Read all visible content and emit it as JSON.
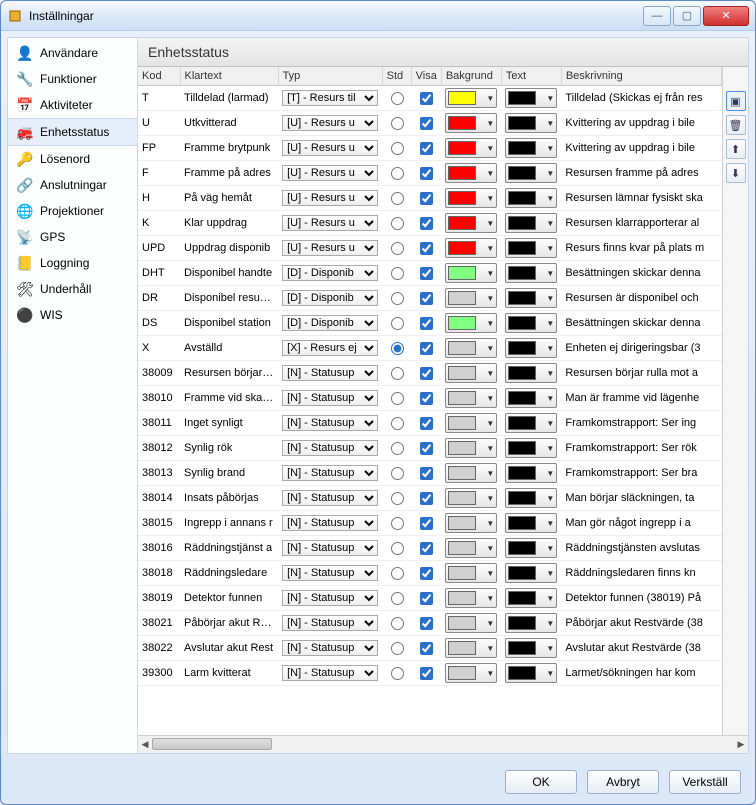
{
  "window": {
    "title": "Inställningar"
  },
  "sidebar": {
    "items": [
      {
        "label": "Användare"
      },
      {
        "label": "Funktioner"
      },
      {
        "label": "Aktiviteter"
      },
      {
        "label": "Enhetsstatus"
      },
      {
        "label": "Lösenord"
      },
      {
        "label": "Anslutningar"
      },
      {
        "label": "Projektioner"
      },
      {
        "label": "GPS"
      },
      {
        "label": "Loggning"
      },
      {
        "label": "Underhåll"
      },
      {
        "label": "WIS"
      }
    ]
  },
  "panel": {
    "title": "Enhetsstatus"
  },
  "columns": {
    "kod": "Kod",
    "klartext": "Klartext",
    "typ": "Typ",
    "std": "Std",
    "visa": "Visa",
    "bakgrund": "Bakgrund",
    "text": "Text",
    "beskrivning": "Beskrivning"
  },
  "typ_options": {
    "T": "[T] - Resurs til",
    "U": "[U] - Resurs u",
    "D": "[D] - Disponib",
    "X": "[X] - Resurs ej",
    "N": "[N] - Statusup"
  },
  "colors": {
    "yellow": "#ffff00",
    "red": "#ff0000",
    "green": "#80ff80",
    "gray": "#d0d0d0",
    "black": "#000000"
  },
  "rows": [
    {
      "kod": "T",
      "klartext": "Tilldelad (larmad)",
      "typ": "T",
      "std": true,
      "visa": true,
      "bg": "yellow",
      "txt": "black",
      "besk": "Tilldelad (Skickas ej från res"
    },
    {
      "kod": "U",
      "klartext": "Utkvitterad",
      "typ": "U",
      "std": false,
      "visa": true,
      "bg": "red",
      "txt": "black",
      "besk": "Kvittering av uppdrag i bile"
    },
    {
      "kod": "FP",
      "klartext": "Framme brytpunk",
      "typ": "U",
      "std": false,
      "visa": true,
      "bg": "red",
      "txt": "black",
      "besk": "Kvittering av uppdrag i bile"
    },
    {
      "kod": "F",
      "klartext": "Framme på adres",
      "typ": "U",
      "std": true,
      "visa": true,
      "bg": "red",
      "txt": "black",
      "besk": "Resursen framme på adres"
    },
    {
      "kod": "H",
      "klartext": "På väg hemåt",
      "typ": "U",
      "std": false,
      "visa": true,
      "bg": "red",
      "txt": "black",
      "besk": "Resursen lämnar fysiskt ska"
    },
    {
      "kod": "K",
      "klartext": "Klar uppdrag",
      "typ": "U",
      "std": false,
      "visa": true,
      "bg": "red",
      "txt": "black",
      "besk": "Resursen klarrapporterar al"
    },
    {
      "kod": "UPD",
      "klartext": "Uppdrag disponib",
      "typ": "U",
      "std": false,
      "visa": true,
      "bg": "red",
      "txt": "black",
      "besk": "Resurs finns kvar på plats m"
    },
    {
      "kod": "DHT",
      "klartext": "Disponibel handte",
      "typ": "D",
      "std": false,
      "visa": true,
      "bg": "green",
      "txt": "black",
      "besk": "Besättningen skickar denna"
    },
    {
      "kod": "DR",
      "klartext": "Disponibel resursa",
      "typ": "D",
      "std": false,
      "visa": true,
      "bg": "gray",
      "txt": "black",
      "besk": "Resursen är disponibel och"
    },
    {
      "kod": "DS",
      "klartext": "Disponibel station",
      "typ": "D",
      "std": true,
      "visa": true,
      "bg": "green",
      "txt": "black",
      "besk": "Besättningen skickar denna"
    },
    {
      "kod": "X",
      "klartext": "Avställd",
      "typ": "X",
      "std": true,
      "visa": true,
      "bg": "gray",
      "txt": "black",
      "besk": "Enheten ej dirigeringsbar (3"
    },
    {
      "kod": "38009",
      "klartext": "Resursen börjar ru",
      "typ": "N",
      "std": false,
      "visa": true,
      "bg": "gray",
      "txt": "black",
      "besk": "Resursen börjar rulla mot a"
    },
    {
      "kod": "38010",
      "klartext": "Framme vid skade",
      "typ": "N",
      "std": false,
      "visa": true,
      "bg": "gray",
      "txt": "black",
      "besk": "Man är framme vid lägenhe"
    },
    {
      "kod": "38011",
      "klartext": "Inget synligt",
      "typ": "N",
      "std": false,
      "visa": true,
      "bg": "gray",
      "txt": "black",
      "besk": "Framkomstrapport: Ser ing"
    },
    {
      "kod": "38012",
      "klartext": "Synlig rök",
      "typ": "N",
      "std": false,
      "visa": true,
      "bg": "gray",
      "txt": "black",
      "besk": "Framkomstrapport: Ser rök"
    },
    {
      "kod": "38013",
      "klartext": "Synlig brand",
      "typ": "N",
      "std": false,
      "visa": true,
      "bg": "gray",
      "txt": "black",
      "besk": "Framkomstrapport: Ser bra"
    },
    {
      "kod": "38014",
      "klartext": "Insats påbörjas",
      "typ": "N",
      "std": false,
      "visa": true,
      "bg": "gray",
      "txt": "black",
      "besk": "Man börjar släckningen, ta"
    },
    {
      "kod": "38015",
      "klartext": "Ingrepp i annans r",
      "typ": "N",
      "std": false,
      "visa": true,
      "bg": "gray",
      "txt": "black",
      "besk": "Man gör något ingrepp i a"
    },
    {
      "kod": "38016",
      "klartext": "Räddningstjänst a",
      "typ": "N",
      "std": false,
      "visa": true,
      "bg": "gray",
      "txt": "black",
      "besk": "Räddningstjänsten avslutas"
    },
    {
      "kod": "38018",
      "klartext": "Räddningsledare",
      "typ": "N",
      "std": false,
      "visa": true,
      "bg": "gray",
      "txt": "black",
      "besk": "Räddningsledaren finns kn"
    },
    {
      "kod": "38019",
      "klartext": "Detektor funnen",
      "typ": "N",
      "std": false,
      "visa": true,
      "bg": "gray",
      "txt": "black",
      "besk": "Detektor funnen (38019) På"
    },
    {
      "kod": "38021",
      "klartext": "Påbörjar akut Rest",
      "typ": "N",
      "std": false,
      "visa": true,
      "bg": "gray",
      "txt": "black",
      "besk": "Påbörjar akut Restvärde (38"
    },
    {
      "kod": "38022",
      "klartext": "Avslutar akut Rest",
      "typ": "N",
      "std": false,
      "visa": true,
      "bg": "gray",
      "txt": "black",
      "besk": "Avslutar akut Restvärde (38"
    },
    {
      "kod": "39300",
      "klartext": "Larm kvitterat",
      "typ": "N",
      "std": false,
      "visa": true,
      "bg": "gray",
      "txt": "black",
      "besk": "Larmet/sökningen har kom"
    }
  ],
  "buttons": {
    "ok": "OK",
    "cancel": "Avbryt",
    "apply": "Verkställ"
  }
}
